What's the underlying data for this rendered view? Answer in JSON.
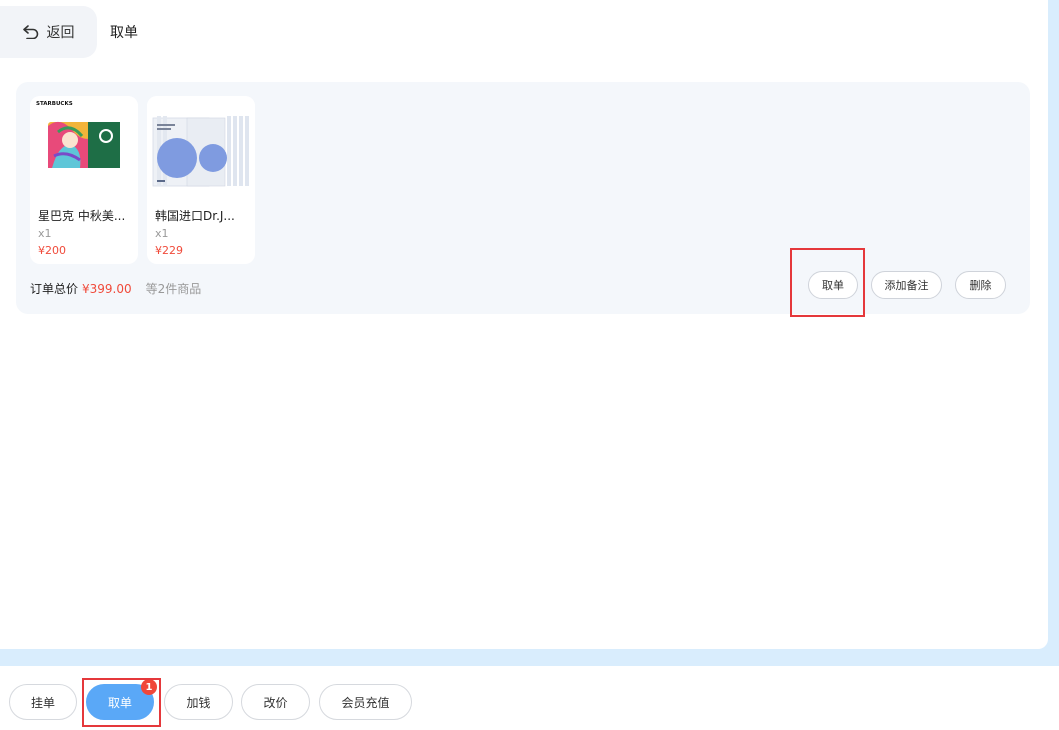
{
  "header": {
    "back_label": "返回",
    "title": "取单"
  },
  "order": {
    "products": [
      {
        "brand_text": "STARBUCKS",
        "name": "星巴克 中秋美...",
        "qty": "x1",
        "price": "¥200",
        "icon": "starbucks-gift-card-image"
      },
      {
        "name": "韩国进口Dr.J...",
        "qty": "x1",
        "price": "¥229",
        "icon": "face-mask-pack-image"
      }
    ],
    "total_label": "订单总价",
    "total_value": "¥399.00",
    "total_count": "等2件商品",
    "actions": {
      "take": "取单",
      "add_note": "添加备注",
      "delete": "删除"
    }
  },
  "bottom_bar": {
    "hold": "挂单",
    "take": "取单",
    "take_badge": "1",
    "add_money": "加钱",
    "change_price": "改价",
    "member_recharge": "会员充值"
  },
  "colors": {
    "background": "#d9edfd",
    "accent": "#5aa8f7",
    "price": "#f04b3b",
    "highlight": "#e5383b"
  }
}
